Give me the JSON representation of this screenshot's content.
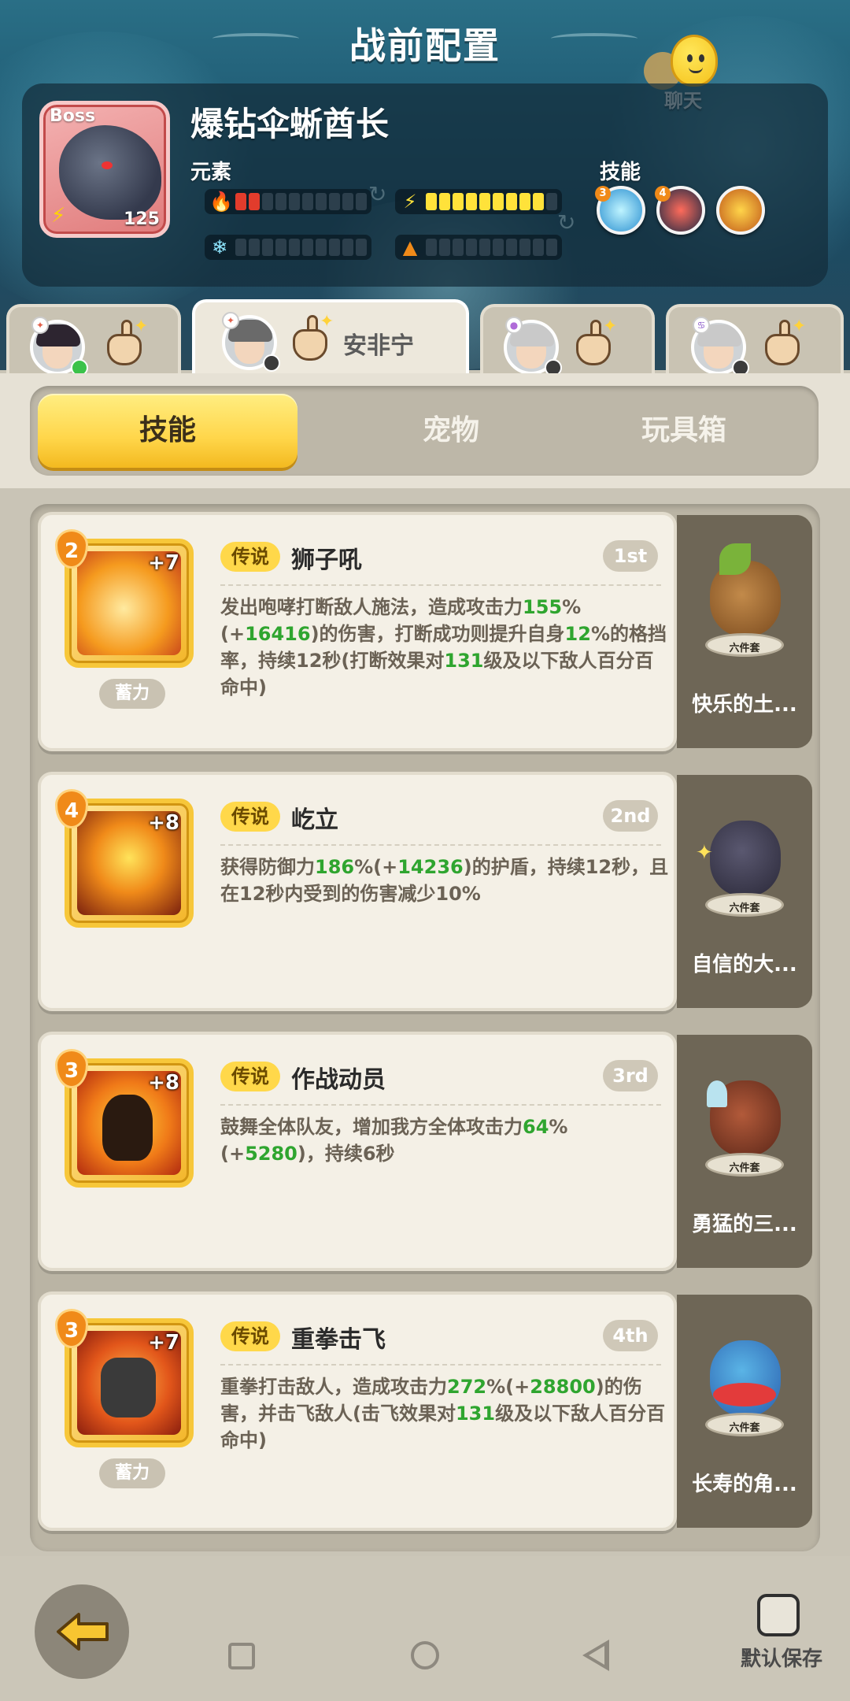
{
  "header": {
    "title": "战前配置",
    "chat_label": "聊天"
  },
  "boss": {
    "tag": "Boss",
    "level": "125",
    "name": "爆钻伞蜥酋长",
    "element_label": "元素",
    "skill_label": "技能",
    "fire_level": 2,
    "lightning_level": 9,
    "ice_level": 0,
    "earth_level": 0,
    "skill_orbs": [
      {
        "icon": "ice-shard-icon",
        "level": "3"
      },
      {
        "icon": "claw-icon",
        "level": "4"
      },
      {
        "icon": "crown-icon",
        "level": ""
      }
    ]
  },
  "heroes": [
    {
      "name": "",
      "icon": "hero-avatar-1"
    },
    {
      "name": "安非宁",
      "icon": "hero-avatar-2"
    },
    {
      "name": "",
      "icon": "hero-avatar-3"
    },
    {
      "name": "",
      "icon": "hero-avatar-4"
    }
  ],
  "tabs": [
    "技能",
    "宠物",
    "玩具箱"
  ],
  "skills": [
    {
      "rank": "2",
      "plus": "+7",
      "tag": "传说",
      "name": "狮子吼",
      "order": "1st",
      "charge": "蓄力",
      "desc": [
        {
          "t": "发出咆哮打断敌人施法，造成攻击力"
        },
        {
          "t": "155",
          "n": 1
        },
        {
          "t": "%(+"
        },
        {
          "t": "16416",
          "n": 1
        },
        {
          "t": ")的伤害，打断成功则提升自身"
        },
        {
          "t": "12",
          "n": 1
        },
        {
          "t": "%的格挡率，持续12秒(打断效果对"
        },
        {
          "t": "131",
          "n": 1
        },
        {
          "t": "级及以下敌人百分百命中)"
        }
      ],
      "pet_name": "快乐的土...",
      "pet_set": "六件套"
    },
    {
      "rank": "4",
      "plus": "+8",
      "tag": "传说",
      "name": "屹立",
      "order": "2nd",
      "charge": "",
      "desc": [
        {
          "t": "获得防御力"
        },
        {
          "t": "186",
          "n": 1
        },
        {
          "t": "%(+"
        },
        {
          "t": "14236",
          "n": 1
        },
        {
          "t": ")的护盾，持续12秒，且在12秒内受到的伤害减少10%"
        }
      ],
      "pet_name": "自信的大...",
      "pet_set": "六件套"
    },
    {
      "rank": "3",
      "plus": "+8",
      "tag": "传说",
      "name": "作战动员",
      "order": "3rd",
      "charge": "",
      "desc": [
        {
          "t": "鼓舞全体队友，增加我方全体攻击力"
        },
        {
          "t": "64",
          "n": 1
        },
        {
          "t": "%(+"
        },
        {
          "t": "5280",
          "n": 1
        },
        {
          "t": ")，持续6秒"
        }
      ],
      "pet_name": "勇猛的三...",
      "pet_set": "六件套"
    },
    {
      "rank": "3",
      "plus": "+7",
      "tag": "传说",
      "name": "重拳击飞",
      "order": "4th",
      "charge": "蓄力",
      "desc": [
        {
          "t": "重拳打击敌人，造成攻击力"
        },
        {
          "t": "272",
          "n": 1
        },
        {
          "t": "%(+"
        },
        {
          "t": "28800",
          "n": 1
        },
        {
          "t": ")的伤害，并击飞敌人(击飞效果对"
        },
        {
          "t": "131",
          "n": 1
        },
        {
          "t": "级及以下敌人百分百命中)"
        }
      ],
      "pet_name": "长寿的角...",
      "pet_set": "六件套"
    }
  ],
  "footer": {
    "save_label": "默认保存"
  },
  "colors": {
    "accent_yellow": "#ffd64a",
    "number_green": "#2fa52f",
    "fire_red": "#e23c2c",
    "bolt_yellow": "#ffe23a"
  }
}
